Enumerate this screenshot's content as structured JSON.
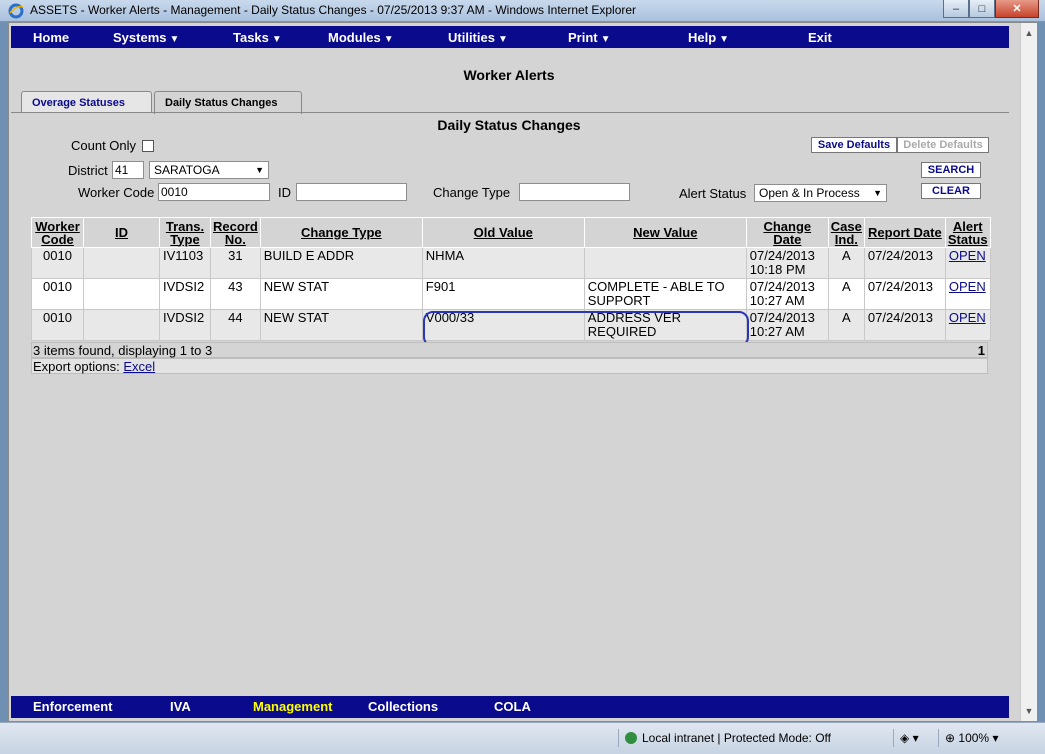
{
  "window": {
    "title": "ASSETS - Worker Alerts - Management - Daily Status Changes -    07/25/2013 9:37 AM - Windows Internet Explorer",
    "minimize": "–",
    "maximize": "□",
    "close": "✕"
  },
  "topnav": [
    {
      "label": "Home",
      "arrow": ""
    },
    {
      "label": "Systems",
      "arrow": "▼"
    },
    {
      "label": "Tasks",
      "arrow": "▼"
    },
    {
      "label": "Modules",
      "arrow": "▼"
    },
    {
      "label": "Utilities",
      "arrow": "▼"
    },
    {
      "label": "Print",
      "arrow": "▼"
    },
    {
      "label": "Help",
      "arrow": "▼"
    },
    {
      "label": "Exit",
      "arrow": ""
    }
  ],
  "page_title": "Worker Alerts",
  "tabs": {
    "overage": "Overage Statuses",
    "daily": "Daily Status Changes"
  },
  "section_title": "Daily Status Changes",
  "filters": {
    "count_only_label": "Count Only",
    "district_label": "District",
    "district_code": "41",
    "district_name": "SARATOGA",
    "worker_code_label": "Worker Code",
    "worker_code_value": "0010",
    "id_label": "ID",
    "id_value": "",
    "change_type_label": "Change Type",
    "change_type_value": "",
    "alert_status_label": "Alert Status",
    "alert_status_value": "Open & In Process"
  },
  "buttons": {
    "save_defaults": "Save Defaults",
    "delete_defaults": "Delete Defaults",
    "search": "SEARCH",
    "clear": "CLEAR"
  },
  "table": {
    "headers": {
      "worker_code": [
        "Worker",
        "Code"
      ],
      "id": "ID",
      "trans_type": [
        "Trans.",
        "Type"
      ],
      "record_no": [
        "Record",
        "No."
      ],
      "change_type": "Change Type",
      "old_value": "Old Value",
      "new_value": "New Value",
      "change_date": [
        "Change",
        "Date"
      ],
      "case_ind": [
        "Case",
        "Ind."
      ],
      "report_date": "Report Date",
      "alert_status": [
        "Alert",
        "Status"
      ]
    },
    "rows": [
      {
        "worker_code": "0010",
        "id": "",
        "trans_type": "IV1103",
        "record_no": "31",
        "change_type": "BUILD E ADDR",
        "old_value": "NHMA",
        "new_value": "",
        "change_date": "07/24/2013",
        "change_time": "10:18 PM",
        "case_ind": "A",
        "report_date": "07/24/2013",
        "alert_status": "OPEN"
      },
      {
        "worker_code": "0010",
        "id": "",
        "trans_type": "IVDSI2",
        "record_no": "43",
        "change_type": "NEW STAT",
        "old_value": "F901",
        "new_value": "COMPLETE - ABLE TO SUPPORT",
        "change_date": "07/24/2013",
        "change_time": "10:27 AM",
        "case_ind": "A",
        "report_date": "07/24/2013",
        "alert_status": "OPEN"
      },
      {
        "worker_code": "0010",
        "id": "",
        "trans_type": "IVDSI2",
        "record_no": "44",
        "change_type": "NEW STAT",
        "old_value": "V000/33",
        "new_value": "ADDRESS VER REQUIRED",
        "change_date": "07/24/2013",
        "change_time": "10:27 AM",
        "case_ind": "A",
        "report_date": "07/24/2013",
        "alert_status": "OPEN"
      }
    ],
    "footer_text": "3 items found, displaying 1 to 3",
    "page_number": "1",
    "export_label": "Export options:",
    "export_link": "Excel"
  },
  "bottomnav": [
    {
      "label": "Enforcement",
      "active": false
    },
    {
      "label": "IVA",
      "active": false
    },
    {
      "label": "Management",
      "active": true
    },
    {
      "label": "Collections",
      "active": false
    },
    {
      "label": "COLA",
      "active": false
    }
  ],
  "statusbar": {
    "zone": "Local intranet | Protected Mode: Off",
    "zoom": "100%"
  },
  "colors": {
    "nav_bg": "#0a0a8c",
    "active_nav": "#ffff00",
    "highlight_ring": "#2a36b8"
  },
  "icons": [
    "ie-icon",
    "dropdown-arrow-icon",
    "globe-icon",
    "zoom-icon"
  ]
}
